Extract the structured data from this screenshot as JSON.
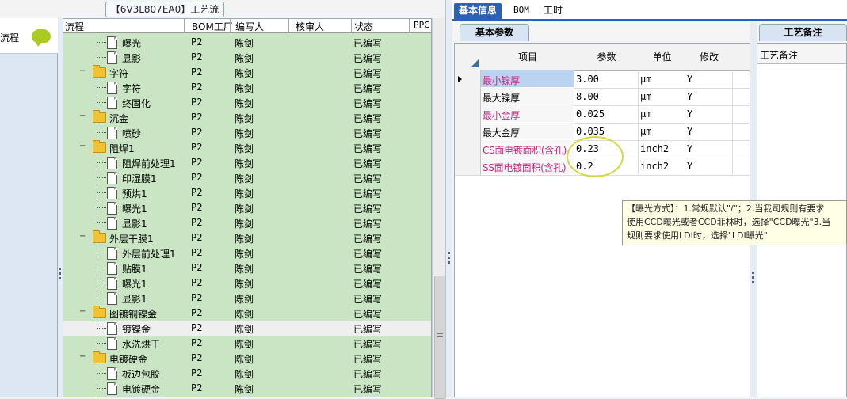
{
  "left_strip": {
    "label": "流程"
  },
  "process_pane": {
    "title": "【6V3L807EA0】工艺流程",
    "columns": [
      "流程",
      "BOM工厂",
      "编写人",
      "核审人",
      "状态",
      "PPC"
    ],
    "rows": [
      {
        "name": "曝光",
        "kind": "doc",
        "level": 2,
        "bom": "P2",
        "author": "陈剑",
        "status": "已编写"
      },
      {
        "name": "显影",
        "kind": "doc",
        "level": 2,
        "bom": "P2",
        "author": "陈剑",
        "status": "已编写"
      },
      {
        "name": "字符",
        "kind": "folder",
        "level": 1,
        "bom": "P2",
        "author": "陈剑",
        "status": "已编写"
      },
      {
        "name": "字符",
        "kind": "doc",
        "level": 2,
        "bom": "P2",
        "author": "陈剑",
        "status": "已编写"
      },
      {
        "name": "终固化",
        "kind": "doc",
        "level": 2,
        "bom": "P2",
        "author": "陈剑",
        "status": "已编写"
      },
      {
        "name": "沉金",
        "kind": "folder",
        "level": 1,
        "bom": "P2",
        "author": "陈剑",
        "status": "已编写"
      },
      {
        "name": "喷砂",
        "kind": "doc",
        "level": 2,
        "bom": "P2",
        "author": "陈剑",
        "status": "已编写"
      },
      {
        "name": "阻焊1",
        "kind": "folder",
        "level": 1,
        "bom": "P2",
        "author": "陈剑",
        "status": "已编写"
      },
      {
        "name": "阻焊前处理1",
        "kind": "doc",
        "level": 2,
        "bom": "P2",
        "author": "陈剑",
        "status": "已编写"
      },
      {
        "name": "印湿膜1",
        "kind": "doc",
        "level": 2,
        "bom": "P2",
        "author": "陈剑",
        "status": "已编写"
      },
      {
        "name": "预烘1",
        "kind": "doc",
        "level": 2,
        "bom": "P2",
        "author": "陈剑",
        "status": "已编写"
      },
      {
        "name": "曝光1",
        "kind": "doc",
        "level": 2,
        "bom": "P2",
        "author": "陈剑",
        "status": "已编写"
      },
      {
        "name": "显影1",
        "kind": "doc",
        "level": 2,
        "bom": "P2",
        "author": "陈剑",
        "status": "已编写"
      },
      {
        "name": "外层干膜1",
        "kind": "folder",
        "level": 1,
        "bom": "P2",
        "author": "陈剑",
        "status": "已编写"
      },
      {
        "name": "外层前处理1",
        "kind": "doc",
        "level": 2,
        "bom": "P2",
        "author": "陈剑",
        "status": "已编写"
      },
      {
        "name": "贴膜1",
        "kind": "doc",
        "level": 2,
        "bom": "P2",
        "author": "陈剑",
        "status": "已编写"
      },
      {
        "name": "曝光1",
        "kind": "doc",
        "level": 2,
        "bom": "P2",
        "author": "陈剑",
        "status": "已编写"
      },
      {
        "name": "显影1",
        "kind": "doc",
        "level": 2,
        "bom": "P2",
        "author": "陈剑",
        "status": "已编写"
      },
      {
        "name": "图镀铜镍金",
        "kind": "folder",
        "level": 1,
        "bom": "P2",
        "author": "陈剑",
        "status": "已编写"
      },
      {
        "name": "镀镍金",
        "kind": "doc",
        "level": 2,
        "bom": "P2",
        "author": "陈剑",
        "status": "已编写",
        "selected": true
      },
      {
        "name": "水洗烘干",
        "kind": "doc",
        "level": 2,
        "bom": "P2",
        "author": "陈剑",
        "status": "已编写"
      },
      {
        "name": "电镀硬金",
        "kind": "folder",
        "level": 1,
        "bom": "P2",
        "author": "陈剑",
        "status": "已编写"
      },
      {
        "name": "板边包胶",
        "kind": "doc",
        "level": 2,
        "bom": "P2",
        "author": "陈剑",
        "status": "已编写"
      },
      {
        "name": "电镀硬金",
        "kind": "doc",
        "level": 2,
        "bom": "P2",
        "author": "陈剑",
        "status": "已编写"
      }
    ]
  },
  "top_tabs": [
    "基本信息",
    "BOM",
    "工时"
  ],
  "params_tab": "基本参数",
  "params_grid": {
    "columns": [
      "项目",
      "参数",
      "单位",
      "修改"
    ],
    "rows": [
      {
        "item": "最小镍厚",
        "value": "3.00",
        "unit": "μm",
        "edit": "Y",
        "pink": true,
        "current": true
      },
      {
        "item": "最大镍厚",
        "value": "8.00",
        "unit": "μm",
        "edit": "Y",
        "pink": false
      },
      {
        "item": "最小金厚",
        "value": "0.025",
        "unit": "μm",
        "edit": "Y",
        "pink": true
      },
      {
        "item": "最大金厚",
        "value": "0.035",
        "unit": "μm",
        "edit": "Y",
        "pink": false
      },
      {
        "item": "CS面电镀面积(含孔)",
        "value": "0.23",
        "unit": "inch2",
        "edit": "Y",
        "pink": true
      },
      {
        "item": "SS面电镀面积(含孔)",
        "value": "0.2",
        "unit": "inch2",
        "edit": "Y",
        "pink": true
      }
    ]
  },
  "notes": {
    "tab": "工艺备注",
    "header": "工艺备注"
  },
  "tooltip": {
    "lines": [
      "【曝光方式】：1.常规默认\"/\"；2.当我司规则有要求",
      "使用CCD曝光或者CCD菲林时，选择\"CCD曝光\"3.当",
      "规则要求使用LDI时，选择\"LDI曝光\""
    ]
  },
  "colors": {
    "accent": "#2a62b8",
    "tree_bg": "#c9e5c3",
    "pink_text": "#c6297f",
    "highlight": "#d6d640"
  }
}
